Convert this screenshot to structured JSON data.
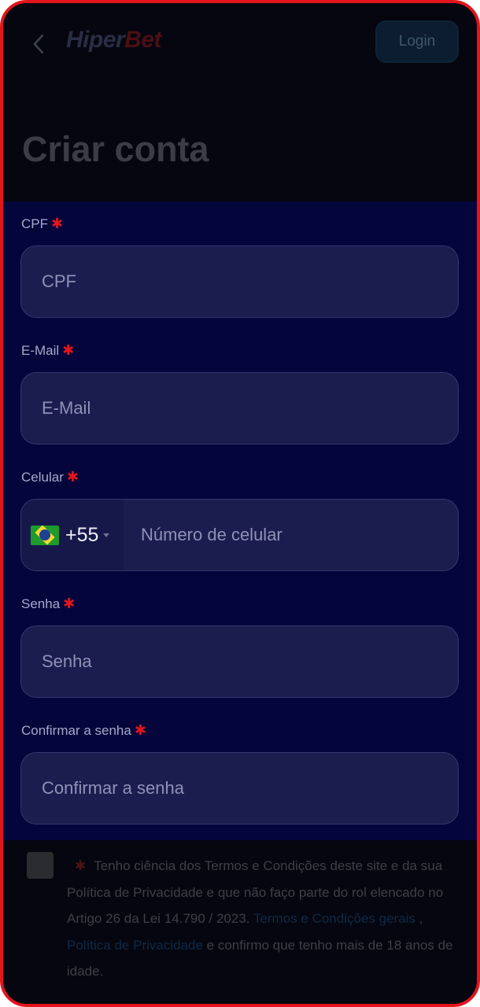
{
  "header": {
    "logo_part1": "Hiper",
    "logo_part2": "Bet",
    "login_label": "Login",
    "title": "Criar conta"
  },
  "form": {
    "cpf": {
      "label": "CPF",
      "placeholder": "CPF"
    },
    "email": {
      "label": "E-Mail",
      "placeholder": "E-Mail"
    },
    "phone": {
      "label": "Celular",
      "country_code": "+55",
      "placeholder": "Número de celular"
    },
    "password": {
      "label": "Senha",
      "placeholder": "Senha"
    },
    "confirm": {
      "label": "Confirmar a senha",
      "placeholder": "Confirmar a senha"
    },
    "required_mark": "✱"
  },
  "terms": {
    "text_before": "Tenho ciência dos Termos e Condições deste site e da sua Política de Privacidade e que não faço parte do rol elencado no Artigo 26 da Lei 14.790 / 2023.",
    "link_terms": "Termos e Condições gerais",
    "separator": ",",
    "link_privacy": "Política de Privacidade",
    "text_after": "e confirmo que tenho mais de 18 anos de idade."
  },
  "icons": {
    "back": "chevron-left-icon",
    "flag": "brazil-flag-icon",
    "caret": "caret-down-icon"
  },
  "colors": {
    "accent_red": "#e3141c",
    "form_bg": "#04053b",
    "input_bg": "#1c1d4f",
    "page_bg": "#05060f"
  }
}
